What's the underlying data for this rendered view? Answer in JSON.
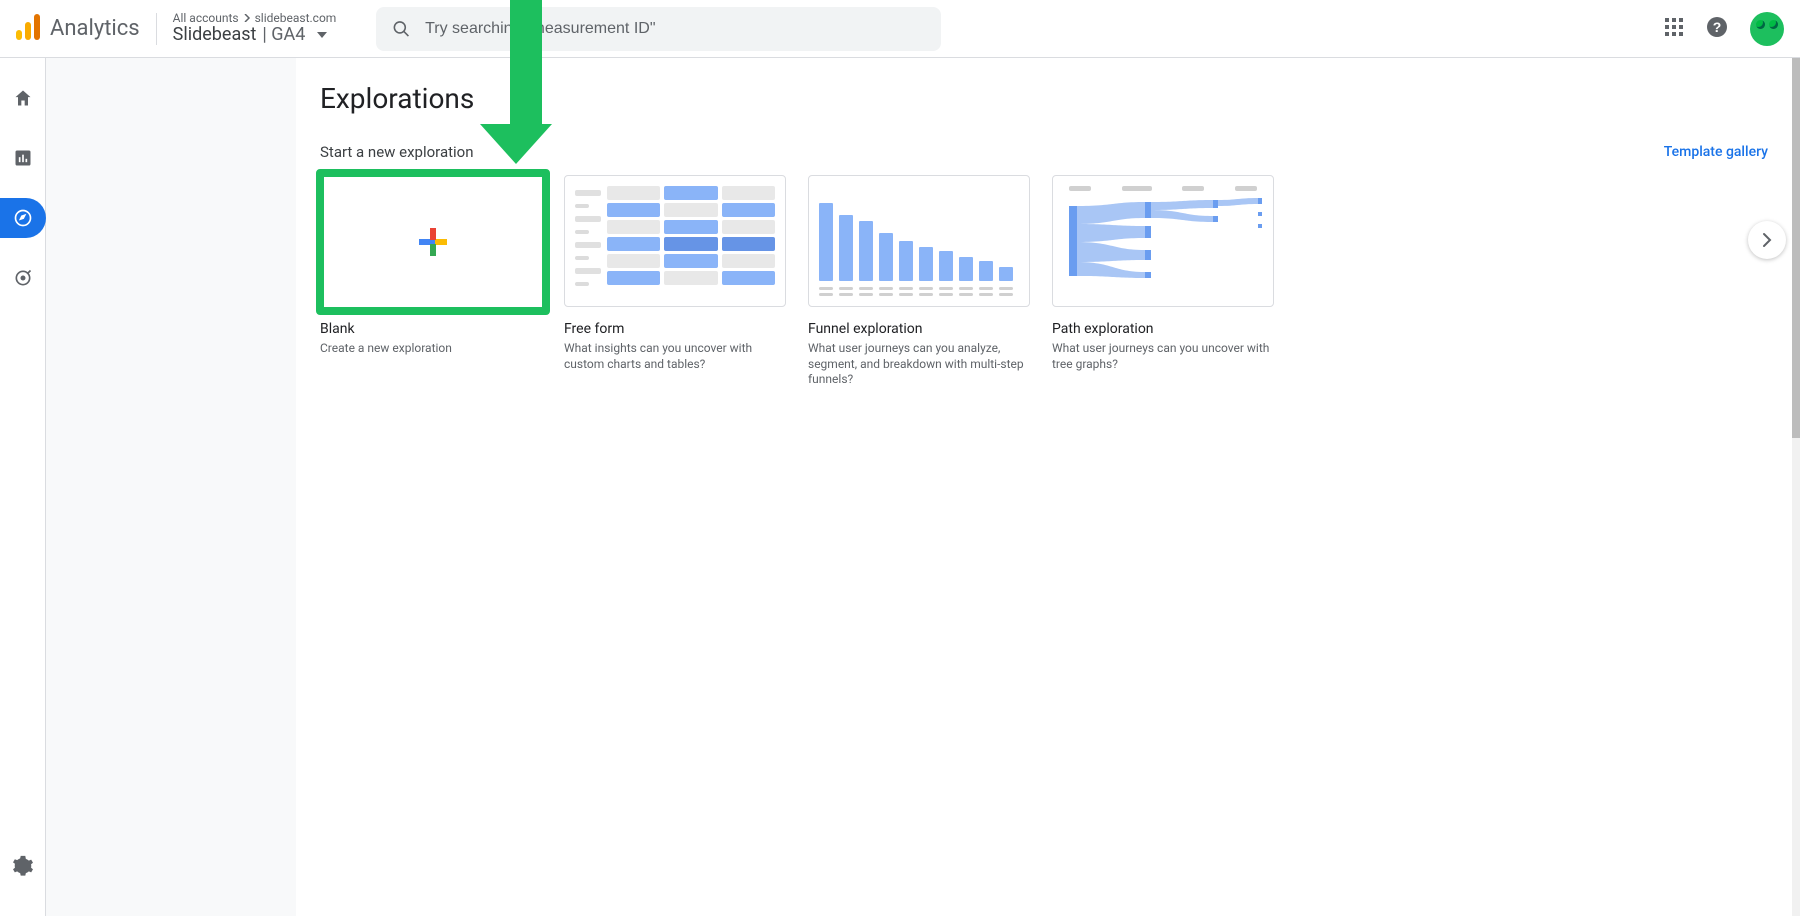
{
  "header": {
    "app_title": "Analytics",
    "breadcrumb_root": "All accounts",
    "breadcrumb_leaf": "slidebeast.com",
    "property_name": "Slidebeast",
    "property_suffix": "| GA4",
    "search_placeholder": "Try searching \"measurement ID\""
  },
  "page": {
    "title": "Explorations",
    "section_label": "Start a new exploration",
    "template_gallery_label": "Template gallery"
  },
  "cards": [
    {
      "title": "Blank",
      "desc": "Create a new exploration"
    },
    {
      "title": "Free form",
      "desc": "What insights can you uncover with custom charts and tables?"
    },
    {
      "title": "Funnel exploration",
      "desc": "What user journeys can you analyze, segment, and breakdown with multi-step funnels?"
    },
    {
      "title": "Path exploration",
      "desc": "What user journeys can you uncover with tree graphs?"
    }
  ]
}
